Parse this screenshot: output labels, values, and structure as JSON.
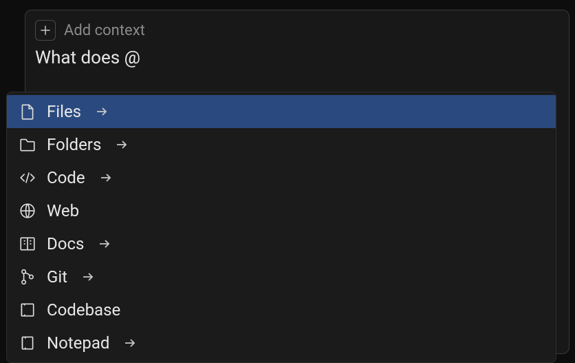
{
  "header": {
    "add_context_label": "Add context"
  },
  "input": {
    "text": "What does @"
  },
  "menu": {
    "items": [
      {
        "label": "Files",
        "icon": "file-icon",
        "has_arrow": true,
        "selected": true
      },
      {
        "label": "Folders",
        "icon": "folder-icon",
        "has_arrow": true,
        "selected": false
      },
      {
        "label": "Code",
        "icon": "code-icon",
        "has_arrow": true,
        "selected": false
      },
      {
        "label": "Web",
        "icon": "globe-icon",
        "has_arrow": false,
        "selected": false
      },
      {
        "label": "Docs",
        "icon": "book-icon",
        "has_arrow": true,
        "selected": false
      },
      {
        "label": "Git",
        "icon": "git-icon",
        "has_arrow": true,
        "selected": false
      },
      {
        "label": "Codebase",
        "icon": "codebase-icon",
        "has_arrow": false,
        "selected": false
      },
      {
        "label": "Notepad",
        "icon": "notepad-icon",
        "has_arrow": true,
        "selected": false
      }
    ]
  }
}
